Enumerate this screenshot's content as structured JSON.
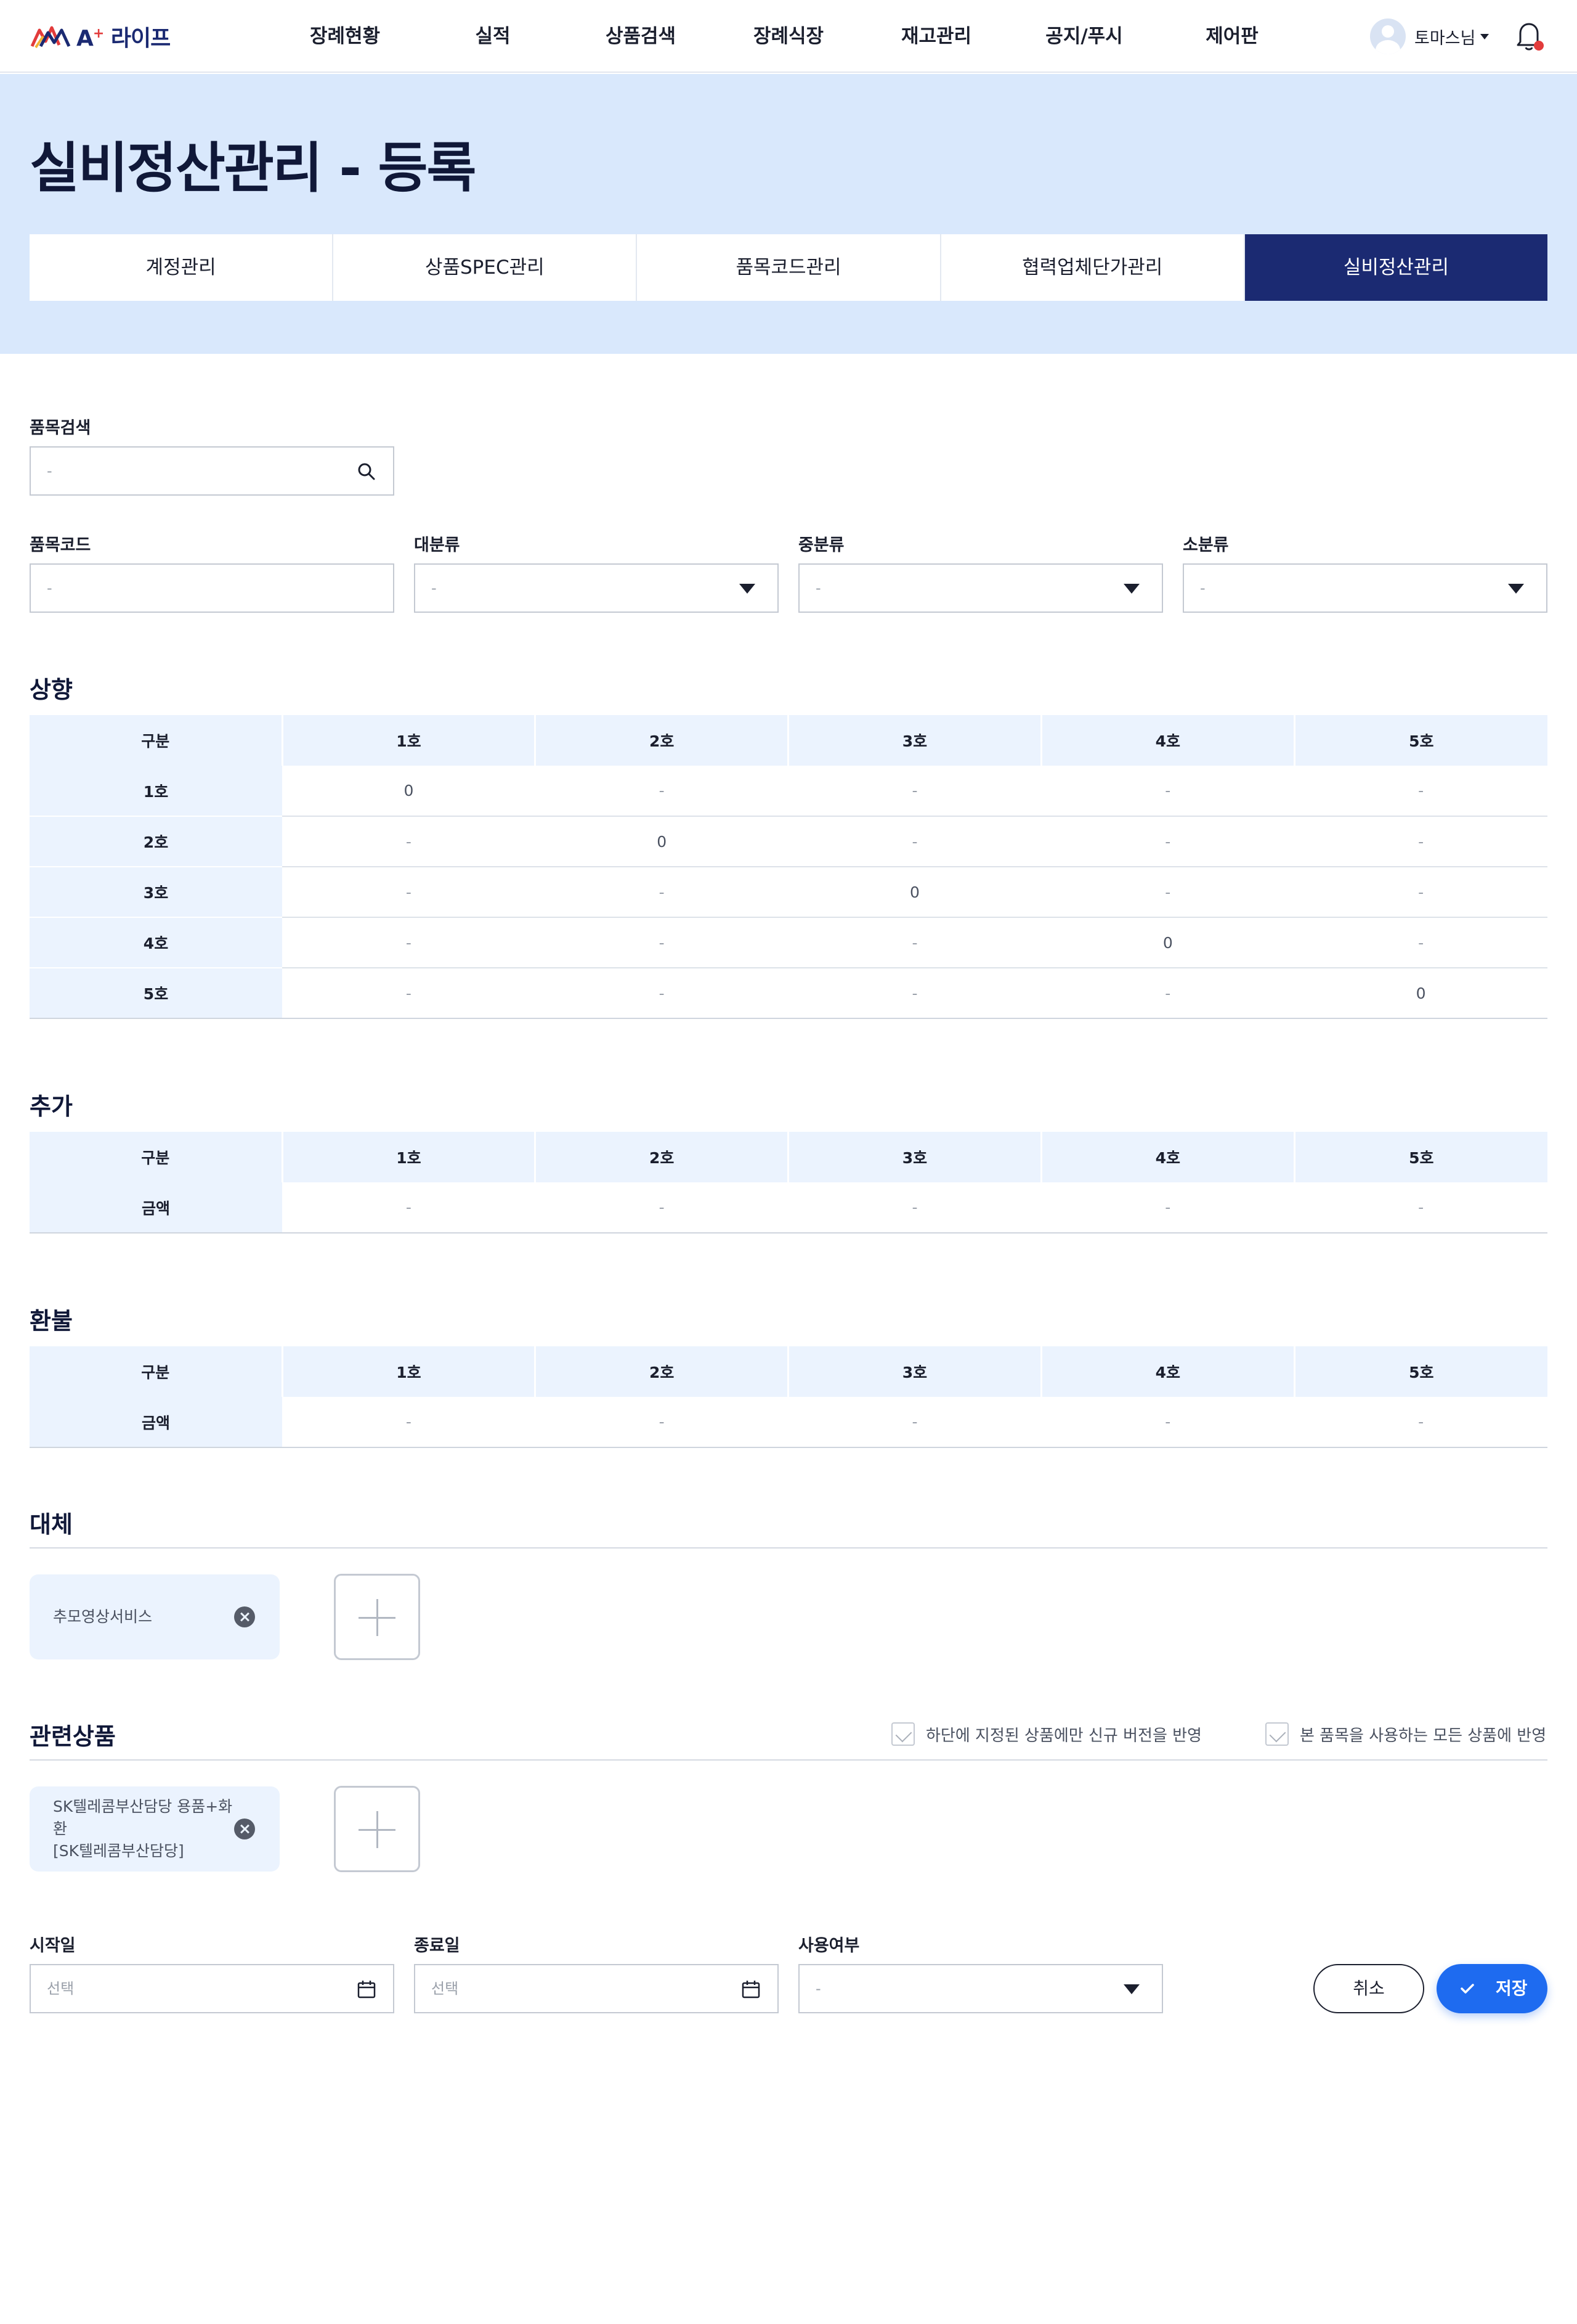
{
  "header": {
    "logo_prefix": "A",
    "logo_plus": "+",
    "logo_text": "라이프",
    "nav": [
      "장례현황",
      "실적",
      "상품검색",
      "장례식장",
      "재고관리",
      "공지/푸시",
      "제어판"
    ],
    "user_name": "토마스님"
  },
  "hero": {
    "title": "실비정산관리 - 등록",
    "tabs": [
      "계정관리",
      "상품SPEC관리",
      "품목코드관리",
      "협력업체단가관리",
      "실비정산관리"
    ],
    "active_tab": "실비정산관리"
  },
  "search": {
    "label": "품목검색",
    "placeholder": "-"
  },
  "filters": {
    "code": {
      "label": "품목코드",
      "value": "-"
    },
    "major": {
      "label": "대분류",
      "value": "-"
    },
    "middle": {
      "label": "중분류",
      "value": "-"
    },
    "minor": {
      "label": "소분류",
      "value": "-"
    }
  },
  "upgrade": {
    "title": "상향",
    "header": [
      "구분",
      "1호",
      "2호",
      "3호",
      "4호",
      "5호"
    ],
    "rows": [
      [
        "1호",
        "0",
        "-",
        "-",
        "-",
        "-"
      ],
      [
        "2호",
        "-",
        "0",
        "-",
        "-",
        "-"
      ],
      [
        "3호",
        "-",
        "-",
        "0",
        "-",
        "-"
      ],
      [
        "4호",
        "-",
        "-",
        "-",
        "0",
        "-"
      ],
      [
        "5호",
        "-",
        "-",
        "-",
        "-",
        "0"
      ]
    ]
  },
  "addition": {
    "title": "추가",
    "header": [
      "구분",
      "1호",
      "2호",
      "3호",
      "4호",
      "5호"
    ],
    "rows": [
      [
        "금액",
        "-",
        "-",
        "-",
        "-",
        "-"
      ]
    ]
  },
  "refund": {
    "title": "환불",
    "header": [
      "구분",
      "1호",
      "2호",
      "3호",
      "4호",
      "5호"
    ],
    "rows": [
      [
        "금액",
        "-",
        "-",
        "-",
        "-",
        "-"
      ]
    ]
  },
  "substitute": {
    "title": "대체",
    "chips": [
      "추모영상서비스"
    ]
  },
  "related": {
    "title": "관련상품",
    "check1": "하단에 지정된 상품에만 신규 버전을 반영",
    "check2": "본 품목을 사용하는 모든 상품에 반영",
    "chip_line1": "SK텔레콤부산담당 용품+화환",
    "chip_line2": "[SK텔레콤부산담당]"
  },
  "dates": {
    "start_label": "시작일",
    "start_placeholder": "선택",
    "end_label": "종료일",
    "end_placeholder": "선택",
    "use_label": "사용여부",
    "use_value": "-"
  },
  "actions": {
    "cancel": "취소",
    "save": "저장"
  },
  "colors": {
    "navy": "#1b2a72",
    "hero_bg": "#d9e8fc",
    "table_head": "#ebf3fe",
    "primary": "#1e6bf0",
    "alert": "#e23b3b"
  }
}
